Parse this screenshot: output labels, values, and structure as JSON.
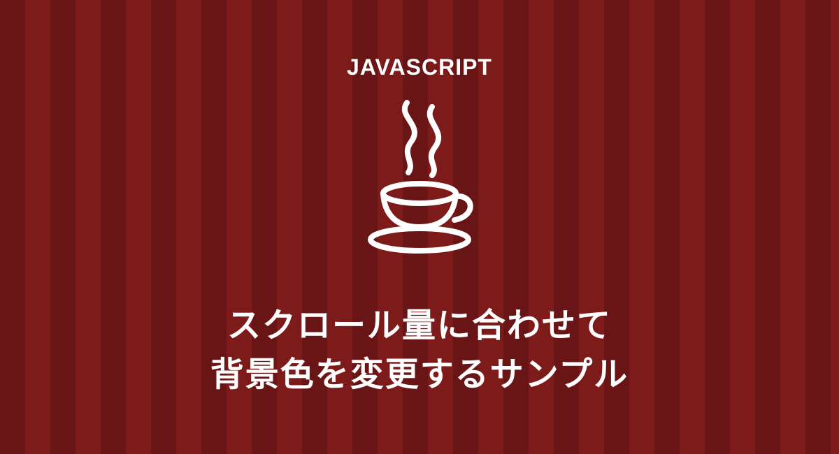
{
  "header": {
    "label": "JAVASCRIPT"
  },
  "icon": {
    "name": "java-coffee"
  },
  "title": {
    "line1": "スクロール量に合わせて",
    "line2": "背景色を変更するサンプル"
  },
  "colors": {
    "stripe_dark": "#6a1515",
    "stripe_light": "#7d1a1a",
    "text": "#ffffff"
  }
}
